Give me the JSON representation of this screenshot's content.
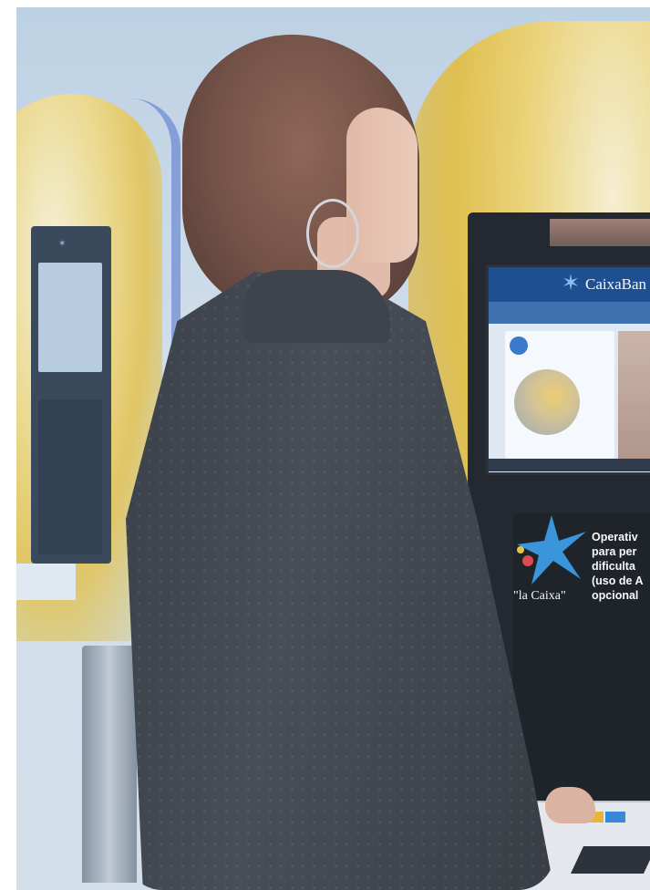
{
  "photo": {
    "screen_brand": "CaixaBan",
    "panel_logo_text": "\"la Caixa\"",
    "panel_lines": [
      "Operativ",
      "para per",
      "dificulta",
      "(uso de A",
      "opcional"
    ]
  },
  "colors": {
    "atm_yellow": "#e7bf3c",
    "caixa_blue": "#0b3f86",
    "star_blue": "#2b8fd9",
    "jacket": "#2b2e33"
  }
}
